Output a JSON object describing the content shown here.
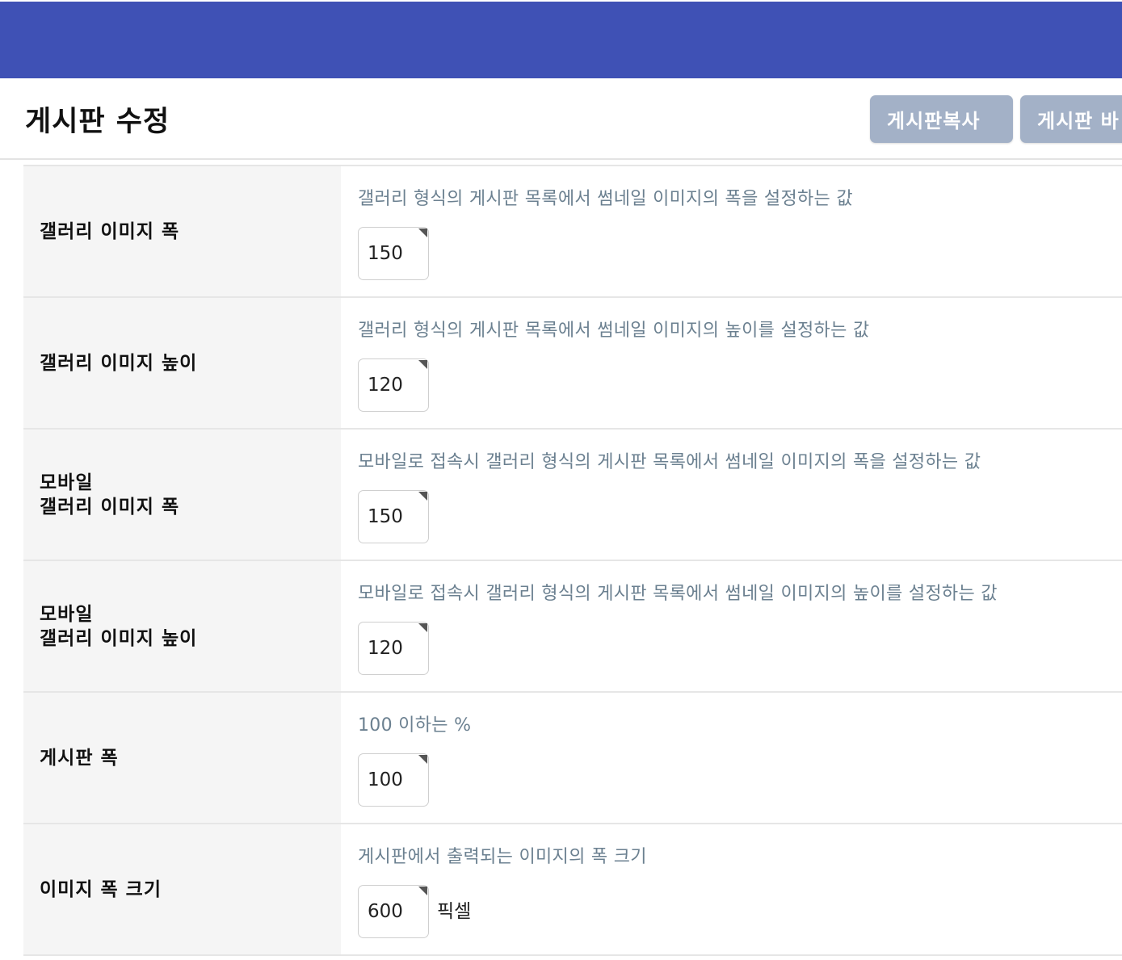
{
  "header": {
    "title": "게시판 수정",
    "copy_button": "게시판복사",
    "manage_button": "게시판 바"
  },
  "rows": [
    {
      "label": "갤러리 이미지 폭",
      "help": "갤러리 형식의 게시판 목록에서 썸네일 이미지의 폭을 설정하는 값",
      "value": "150",
      "unit": ""
    },
    {
      "label": "갤러리 이미지 높이",
      "help": "갤러리 형식의 게시판 목록에서 썸네일 이미지의 높이를 설정하는 값",
      "value": "120",
      "unit": ""
    },
    {
      "label": "모바일\n갤러리 이미지 폭",
      "help": "모바일로 접속시 갤러리 형식의 게시판 목록에서 썸네일 이미지의 폭을 설정하는 값",
      "value": "150",
      "unit": ""
    },
    {
      "label": "모바일\n갤러리 이미지 높이",
      "help": "모바일로 접속시 갤러리 형식의 게시판 목록에서 썸네일 이미지의 높이를 설정하는 값",
      "value": "120",
      "unit": ""
    },
    {
      "label": "게시판 폭",
      "help": "100 이하는 %",
      "value": "100",
      "unit": ""
    },
    {
      "label": "이미지 폭 크기",
      "help": "게시판에서 출력되는 이미지의 폭 크기",
      "value": "600",
      "unit": "픽셀"
    }
  ]
}
